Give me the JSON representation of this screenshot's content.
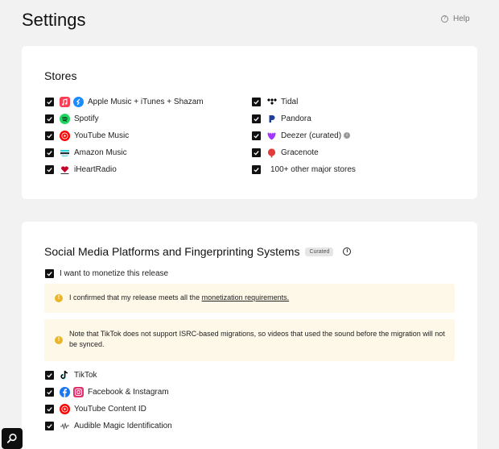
{
  "page": {
    "title": "Settings",
    "help_label": "Help"
  },
  "stores": {
    "title": "Stores",
    "left": [
      {
        "label": "Apple Music + iTunes + Shazam",
        "checked": true,
        "icons": [
          "apple-music-icon",
          "shazam-icon"
        ]
      },
      {
        "label": "Spotify",
        "checked": true,
        "icons": [
          "spotify-icon"
        ]
      },
      {
        "label": "YouTube Music",
        "checked": true,
        "icons": [
          "youtube-music-icon"
        ]
      },
      {
        "label": "Amazon Music",
        "checked": true,
        "icons": [
          "amazon-music-icon"
        ]
      },
      {
        "label": "iHeartRadio",
        "checked": true,
        "icons": [
          "iheartradio-icon"
        ]
      }
    ],
    "right": [
      {
        "label": "Tidal",
        "checked": true,
        "icons": [
          "tidal-icon"
        ]
      },
      {
        "label": "Pandora",
        "checked": true,
        "icons": [
          "pandora-icon"
        ]
      },
      {
        "label": "Deezer (curated)",
        "checked": true,
        "icons": [
          "deezer-icon",
          "info-icon"
        ]
      },
      {
        "label": "Gracenote",
        "checked": true,
        "icons": [
          "gracenote-icon"
        ]
      },
      {
        "label": "100+ other major stores",
        "checked": true,
        "icons": []
      }
    ]
  },
  "social": {
    "title": "Social Media Platforms and Fingerprinting Systems",
    "badge": "Curated",
    "monetize_label": "I want to monetize this release",
    "notice1_text": "I confirmed that my release meets all the ",
    "notice1_link": "monetization requirements.",
    "notice2_text": "Note that TikTok does not support ISRC-based migrations, so videos that used the sound before the migration will not be synced.",
    "platforms": [
      {
        "label": "TikTok",
        "checked": true,
        "icons": [
          "tiktok-icon"
        ]
      },
      {
        "label": "Facebook & Instagram",
        "checked": true,
        "icons": [
          "facebook-icon",
          "instagram-icon"
        ]
      },
      {
        "label": "YouTube Content ID",
        "checked": true,
        "icons": [
          "youtube-content-id-icon"
        ]
      },
      {
        "label": "Audible Magic Identification",
        "checked": true,
        "icons": [
          "audible-magic-icon"
        ]
      }
    ]
  },
  "colors": {
    "background": "#f2f2f2",
    "card": "#ffffff",
    "checkbox": "#111111",
    "notice_bg": "#fdf8e8",
    "warning": "#e9b52b"
  }
}
